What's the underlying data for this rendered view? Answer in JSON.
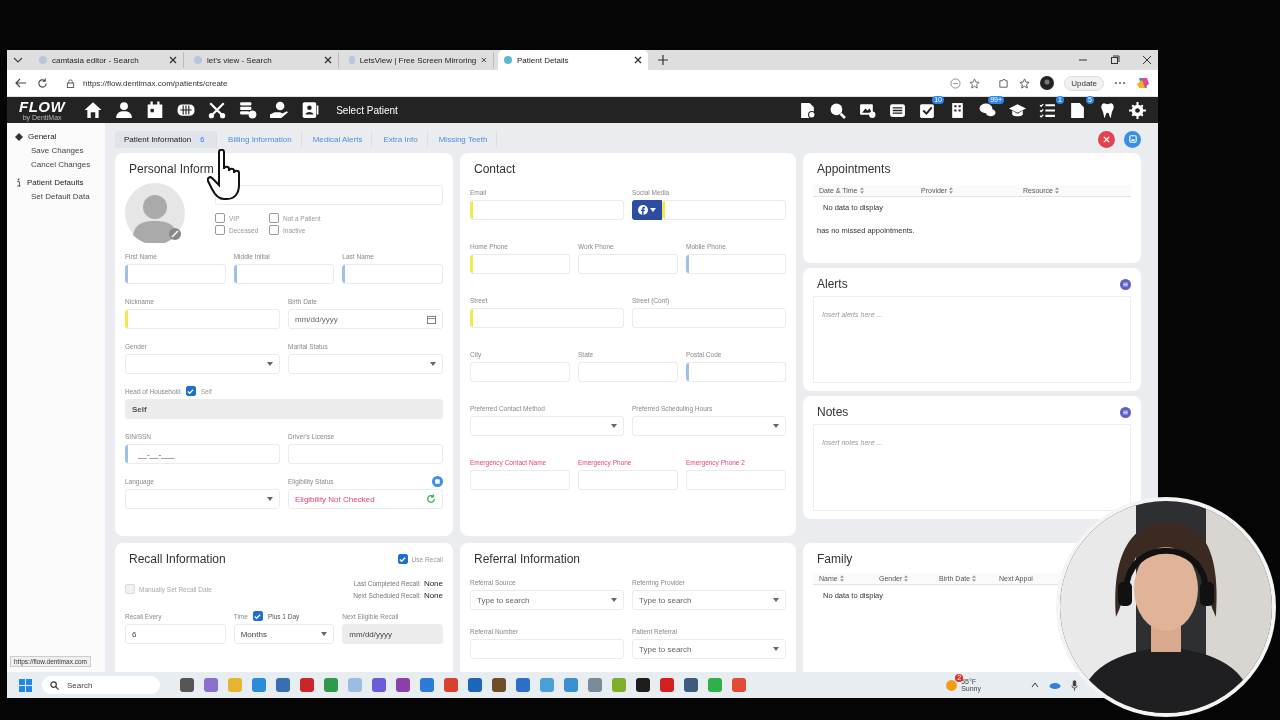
{
  "browser": {
    "tabs": [
      {
        "title": "camtasia editor - Search",
        "selected": false
      },
      {
        "title": "let's view - Search",
        "selected": false
      },
      {
        "title": "LetsView | Free Screen Mirroring",
        "selected": false
      },
      {
        "title": "Patient Details",
        "selected": true
      }
    ],
    "url": "https://flow.dentimax.com/patients/create",
    "update_label": "Update",
    "status_url": "https://flow.dentimax.com"
  },
  "app": {
    "logo": "FLOW",
    "logo_sub": "by DentiMax",
    "title": "Select Patient",
    "badges": {
      "tasks": "10",
      "messages": "99+",
      "checklist": "1",
      "documents": "5"
    }
  },
  "sidebar": [
    {
      "title": "General",
      "items": [
        "Save Changes",
        "Cancel Changes"
      ]
    },
    {
      "title": "Patient Defaults",
      "items": [
        "Set Default Data"
      ]
    }
  ],
  "tabs": [
    {
      "label": "Patient Information",
      "badge": "6",
      "selected": true
    },
    {
      "label": "Billing Information",
      "selected": false
    },
    {
      "label": "Medical Alerts",
      "selected": false
    },
    {
      "label": "Extra Info",
      "selected": false
    },
    {
      "label": "Missing Teeth",
      "selected": false
    }
  ],
  "personal": {
    "title": "Personal Inform",
    "flags": [
      {
        "label": "VIP",
        "checked": false
      },
      {
        "label": "Not a Patient",
        "checked": false
      },
      {
        "label": "Deceased",
        "checked": false
      },
      {
        "label": "Inactive",
        "checked": false
      }
    ],
    "rows": [
      [
        {
          "label": "First Name",
          "kind": "text",
          "color": "#9fc0ee"
        },
        {
          "label": "Middle Initial",
          "kind": "text",
          "color": "#9fc0ee"
        },
        {
          "label": "Last Name",
          "kind": "text",
          "color": "#9fc0ee"
        }
      ],
      [
        {
          "label": "Nickname",
          "kind": "text",
          "color": "#f0ea4a"
        },
        {
          "label": "Birth Date",
          "kind": "date",
          "placeholder": "mm/dd/yyyy"
        }
      ],
      [
        {
          "label": "Gender",
          "kind": "select"
        },
        {
          "label": "Marital Status",
          "kind": "select"
        }
      ],
      [
        {
          "label": "Head of Household",
          "kind": "readonly",
          "value": "Self",
          "check_label": "Self",
          "checked": true
        }
      ],
      [
        {
          "label": "SIN/SSN",
          "kind": "text",
          "color": "#9fc0ee",
          "value": "__-__-___"
        },
        {
          "label": "Driver's License",
          "kind": "text"
        }
      ],
      [
        {
          "label": "Language",
          "kind": "select"
        },
        {
          "label": "Eligibility Status",
          "kind": "status",
          "value": "Eligibility Not Checked"
        }
      ]
    ]
  },
  "contact": {
    "title": "Contact",
    "rows": [
      [
        {
          "label": "Email",
          "kind": "text",
          "color": "#f0ea4a"
        },
        {
          "label": "Social Media",
          "kind": "social",
          "color": "#f0ea4a"
        }
      ],
      [
        {
          "label": "Home Phone",
          "kind": "text",
          "color": "#f0ea4a"
        },
        {
          "label": "Work Phone",
          "kind": "text"
        },
        {
          "label": "Mobile Phone",
          "kind": "text",
          "color": "#9fc0ee"
        }
      ],
      [
        {
          "label": "Street",
          "kind": "text",
          "color": "#f0ea4a"
        },
        {
          "label": "Street (Cont)",
          "kind": "text"
        }
      ],
      [
        {
          "label": "City",
          "kind": "text"
        },
        {
          "label": "State",
          "kind": "text"
        },
        {
          "label": "Postal Code",
          "kind": "text",
          "color": "#9fc0ee"
        }
      ],
      [
        {
          "label": "Preferred Contact Method",
          "kind": "select"
        },
        {
          "label": "Preferred Scheduling Hours",
          "kind": "select"
        }
      ],
      [
        {
          "label": "Emergency Contact Name",
          "kind": "text",
          "required": true
        },
        {
          "label": "Emergency Phone",
          "kind": "text",
          "required": true
        },
        {
          "label": "Emergency Phone 2",
          "kind": "text",
          "required": true
        }
      ]
    ]
  },
  "appointments": {
    "title": "Appointments",
    "columns": [
      "Date & Time",
      "Provider",
      "Resource"
    ],
    "empty": "No data to display",
    "note": "has no missed appointments."
  },
  "alerts": {
    "title": "Alerts",
    "placeholder": "Insert alerts here ..."
  },
  "notes": {
    "title": "Notes",
    "placeholder": "Insert notes here ..."
  },
  "recall": {
    "title": "Recall Information",
    "use_recall": {
      "label": "Use Recall",
      "checked": true
    },
    "manual": {
      "label": "Manually Set Recall Date",
      "checked": false,
      "disabled": true
    },
    "last": {
      "label": "Last Completed Recall:",
      "value": "None"
    },
    "next": {
      "label": "Next Scheduled Recall:",
      "value": "None"
    },
    "rows": [
      [
        {
          "label": "Recall Every",
          "kind": "text",
          "value": "6"
        },
        {
          "label": "Time",
          "kind": "select",
          "value": "Months",
          "check_label": "Plus 1 Day",
          "checked": true
        },
        {
          "label": "Next Eligible Recall",
          "kind": "date",
          "placeholder": "mm/dd/yyyy",
          "disabled": true
        }
      ]
    ]
  },
  "referral": {
    "title": "Referral Information",
    "rows": [
      [
        {
          "label": "Referral Source",
          "kind": "select",
          "placeholder": "Type to search"
        },
        {
          "label": "Referring Provider",
          "kind": "select",
          "placeholder": "Type to search"
        }
      ],
      [
        {
          "label": "Referral Number",
          "kind": "text"
        },
        {
          "label": "Patient Referral",
          "kind": "select",
          "placeholder": "Type to search"
        }
      ]
    ]
  },
  "family": {
    "title": "Family",
    "columns": [
      "Name",
      "Gender",
      "Birth Date",
      "Next Appoi"
    ],
    "empty": "No data to display"
  },
  "taskbar": {
    "search": "Search",
    "weather": {
      "temp": "55°F",
      "desc": "Sunny",
      "badge": "2"
    }
  }
}
